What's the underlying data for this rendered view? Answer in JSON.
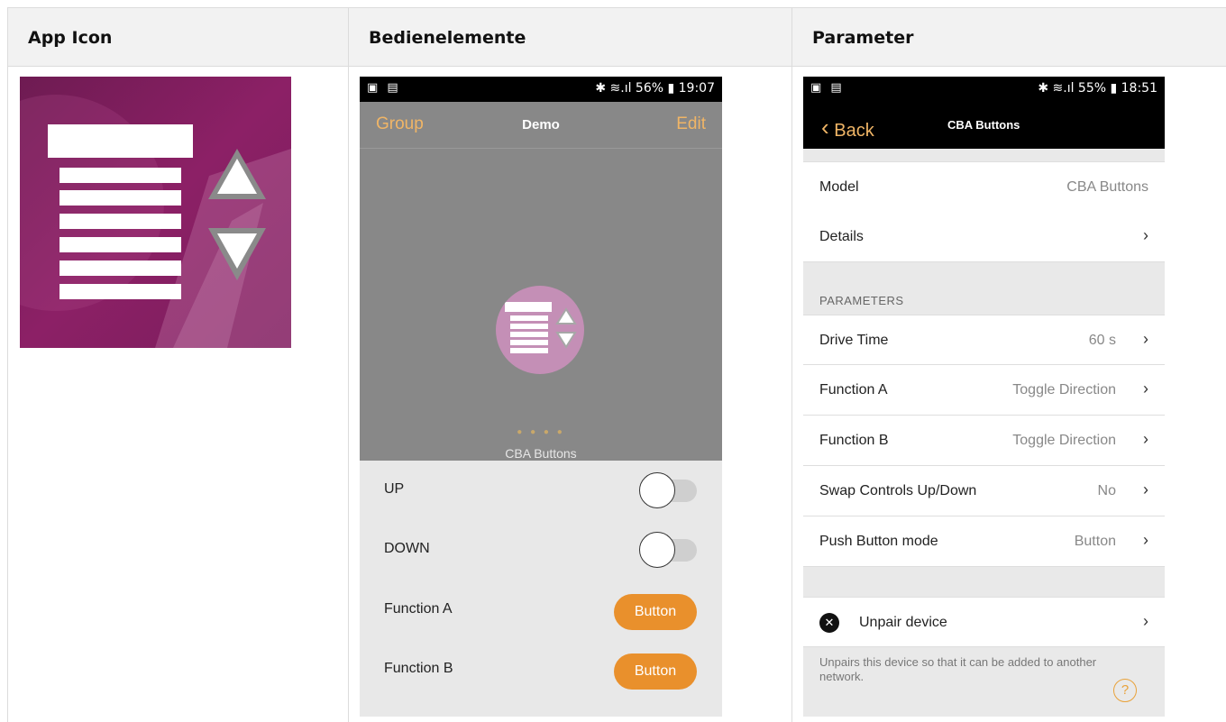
{
  "headers": {
    "col1": "App Icon",
    "col2": "Bedienelemente",
    "col3": "Parameter"
  },
  "phone1": {
    "status_left": "▣ ▤",
    "status_right": "✱ ≋.ıl 56% ▮ 19:07",
    "nav_left": "Group",
    "nav_title": "Demo",
    "nav_right": "Edit",
    "device_dots": "● ● ● ●",
    "device_label": "CBA Buttons",
    "controls": [
      {
        "label": "UP",
        "type": "toggle",
        "on": false
      },
      {
        "label": "DOWN",
        "type": "toggle",
        "on": false
      },
      {
        "label": "Function A",
        "type": "button",
        "button_label": "Button"
      },
      {
        "label": "Function B",
        "type": "button",
        "button_label": "Button"
      }
    ]
  },
  "phone2": {
    "status_left": "▣ ▤",
    "status_right": "✱ ≋.ıl 55% ▮ 18:51",
    "back_label": "Back",
    "nav_title": "CBA Buttons",
    "model": {
      "label": "Model",
      "value": "CBA Buttons"
    },
    "details": {
      "label": "Details"
    },
    "section_parameters": "PARAMETERS",
    "parameters": [
      {
        "label": "Drive Time",
        "value": "60 s"
      },
      {
        "label": "Function A",
        "value": "Toggle Direction"
      },
      {
        "label": "Function B",
        "value": "Toggle Direction"
      },
      {
        "label": "Swap Controls Up/Down",
        "value": "No"
      },
      {
        "label": "Push Button mode",
        "value": "Button"
      }
    ],
    "unpair": {
      "label": "Unpair device",
      "note": "Unpairs this device so that it can be added to another network."
    },
    "chevron": "›",
    "back_chevron": "‹",
    "help_glyph": "?",
    "close_glyph": "✕"
  },
  "colors": {
    "accent_orange": "#e9902c",
    "nav_orange_text": "#f0b566",
    "icon_magenta": "#7c1e5b"
  },
  "icons": [
    "shutter-icon",
    "arrow-up-icon",
    "arrow-down-icon",
    "bluetooth-icon",
    "wifi-icon",
    "battery-icon",
    "chevron-right-icon",
    "close-icon",
    "help-icon"
  ]
}
